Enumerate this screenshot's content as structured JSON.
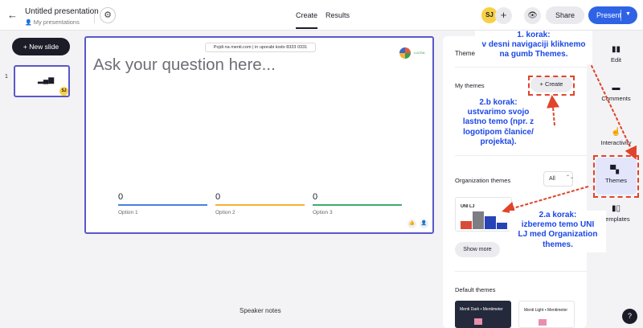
{
  "topbar": {
    "title": "Untitled presentation",
    "subtitle": "My presentations",
    "tabs": [
      "Create",
      "Results"
    ],
    "avatar": "SJ",
    "share": "Share",
    "present": "Present"
  },
  "sidebar": {
    "new_slide": "+ New slide",
    "slide_number": "1",
    "slide_avatar": "SJ"
  },
  "slide": {
    "join_text": "Pojdi na menti.com | in uporabi kodo  8333 0331",
    "question": "Ask your question here...",
    "logo_text": "LUCRA",
    "options": [
      {
        "value": "0",
        "label": "Option 1",
        "color": "#4a7fe0"
      },
      {
        "value": "0",
        "label": "Option 2",
        "color": "#f2b233"
      },
      {
        "value": "0",
        "label": "Option 3",
        "color": "#3cae6a"
      }
    ]
  },
  "speaker_notes": "Speaker notes",
  "themes_panel": {
    "title": "Themes",
    "my_themes": "My themes",
    "create": "+ Create",
    "organization_themes": "Organization themes",
    "filter": "All",
    "org_theme_name": "UNI LJ",
    "show_more": "Show more",
    "default_themes": "Default themes",
    "default_dark": "Menti Dark",
    "default_light": "Menti Light",
    "mentimeter": "Mentimeter"
  },
  "rail": {
    "edit": "Edit",
    "comments": "Comments",
    "interactivity": "Interactivity",
    "themes": "Themes",
    "templates": "Templates"
  },
  "help": "?",
  "annotations": {
    "step1": [
      "1. korak:",
      "v desni navigaciji kliknemo",
      "na gumb Themes."
    ],
    "step2b": [
      "2.b korak:",
      "ustvarimo svojo",
      "lastno temo (npr. z",
      "logotipom članice/",
      "projekta)."
    ],
    "step2a": [
      "2.a korak:",
      "izberemo temo UNI",
      "LJ med Organization",
      "themes."
    ]
  },
  "colors": {
    "accent": "#5a58c8",
    "present": "#2f63e6",
    "annotation_text": "#1a47e6",
    "annotation_arrow": "#e0442a"
  }
}
